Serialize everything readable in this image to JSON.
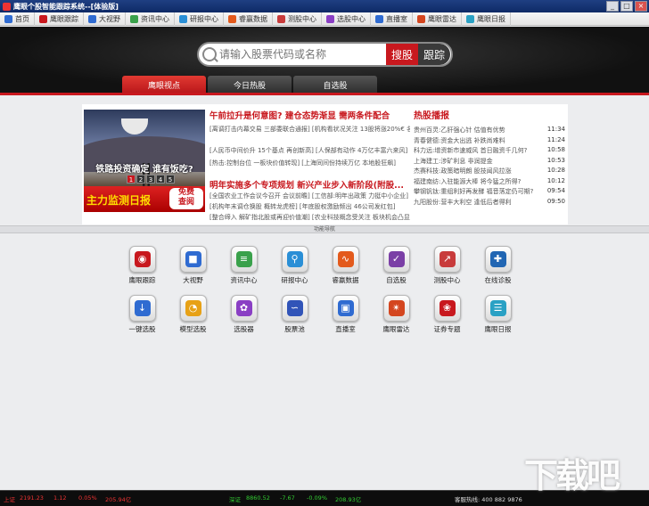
{
  "app": {
    "title": "鹰眼个股智能跟踪系统--[体验版]"
  },
  "window": {
    "minimize": "_",
    "maximize": "□",
    "close": "×"
  },
  "menu": [
    "首页",
    "鹰眼跟踪",
    "大视野",
    "资讯中心",
    "研报中心",
    "睿赢数据",
    "测股中心",
    "选股中心",
    "直播室",
    "鹰眼雷达",
    "鹰眼日报"
  ],
  "search": {
    "placeholder": "请输入股票代码或名称",
    "search_btn": "搜股",
    "follow_btn": "跟踪"
  },
  "tabs": [
    "鹰眼视点",
    "今日热股",
    "自选股"
  ],
  "banner": {
    "caption": "铁路投资确定 谁有饭吃?",
    "pages": [
      "1",
      "2",
      "3",
      "4",
      "5"
    ],
    "promo": "主力监测日报",
    "free_line1": "免费",
    "free_line2": "查阅"
  },
  "news": {
    "headline1": "午前拉升是何意图? 建仓态势渐显 需两条件配合",
    "items1": [
      "[离调打击内幕交易 三部委联合通报] [机构看状况关注 13股将涨20%€ 名单]",
      "[人民币中间价升 15个基点 再创新高] [人保部有动作 4万亿丰富六来风]",
      "[热击:控制台位 一板块价值转现] [上海同间份持续万亿 本地股狂飙]"
    ],
    "headline2": "明年实施多个专项规划 新兴产业步入新阶段(附股...",
    "items2": [
      "[全国农业工作会议今召开 会议前瞻] [工信部:明年出政策 力挺中小企业]",
      "[机构年末调仓换股 概转龙虎榜] [年底股权激励频出 46公司发红包]",
      "[整合缔入 解矿指北股或再迎价值潮] [农业科技概念受关注 板块机会凸显]"
    ]
  },
  "hot": {
    "title": "热股播报",
    "rows": [
      {
        "text": "贵州百灵:乙肝强心针 估值有优势",
        "time": "11:34"
      },
      {
        "text": "青春健德:资金大出逃 补跌尚难料",
        "time": "11:24"
      },
      {
        "text": "科力远:增资新市速威风 首日融资千几何?",
        "time": "10:58"
      },
      {
        "text": "上海建工:涉矿利息 非润提金",
        "time": "10:53"
      },
      {
        "text": "杰赛科技:政策暗明朗 股技闻风拉涨",
        "time": "10:28"
      },
      {
        "text": "福建南纺:入驻能源大棒 将今猛之所得?",
        "time": "10:12"
      },
      {
        "text": "攀钢钒钛:重组利好再发酵 福音落定仍可期?",
        "time": "09:54"
      },
      {
        "text": "九阳股份:营丰大利空 逢低后者得利",
        "time": "09:50"
      }
    ]
  },
  "section": {
    "title": "功能导航"
  },
  "functions": [
    {
      "label": "鹰眼跟踪",
      "icon": "eye-icon",
      "color": "#c8181e",
      "glyph": "◉"
    },
    {
      "label": "大视野",
      "icon": "camera-icon",
      "color": "#2f6bd1",
      "glyph": "■"
    },
    {
      "label": "资讯中心",
      "icon": "books-icon",
      "color": "#3aa14b",
      "glyph": "≡"
    },
    {
      "label": "研报中心",
      "icon": "magnifier-icon",
      "color": "#2a8fd6",
      "glyph": "⚲"
    },
    {
      "label": "睿赢数据",
      "icon": "wave-chart-icon",
      "color": "#e35a1c",
      "glyph": "∿"
    },
    {
      "label": "自选股",
      "icon": "checklist-icon",
      "color": "#7b3fa6",
      "glyph": "✓"
    },
    {
      "label": "测股中心",
      "icon": "line-chart-icon",
      "color": "#c83b3b",
      "glyph": "↗"
    },
    {
      "label": "在线诊股",
      "icon": "tools-icon",
      "color": "#2166b3",
      "glyph": "✚"
    },
    {
      "label": "一键选股",
      "icon": "download-arrow-icon",
      "color": "#2f6bd1",
      "glyph": "↓"
    },
    {
      "label": "模型选股",
      "icon": "pie-chart-icon",
      "color": "#e7a116",
      "glyph": "◔"
    },
    {
      "label": "选股器",
      "icon": "gear-icon",
      "color": "#8a3fc4",
      "glyph": "✿"
    },
    {
      "label": "股票池",
      "icon": "trend-icon",
      "color": "#3154b8",
      "glyph": "∽"
    },
    {
      "label": "直播室",
      "icon": "tv-icon",
      "color": "#2f6bd1",
      "glyph": "▣"
    },
    {
      "label": "鹰眼雷达",
      "icon": "radar-icon",
      "color": "#d4461f",
      "glyph": "✴"
    },
    {
      "label": "证券专题",
      "icon": "flower-icon",
      "color": "#c8181e",
      "glyph": "❀"
    },
    {
      "label": "鹰眼日报",
      "icon": "report-icon",
      "color": "#2aa1c4",
      "glyph": "☰"
    }
  ],
  "status": {
    "sh_label": "上证",
    "sh_value": "2191.23",
    "sh_change": "1.12",
    "sh_pct": "0.05%",
    "sh_amount": "205.94亿",
    "sz_label": "深证",
    "sz_value": "8860.52",
    "sz_change": "-7.67",
    "sz_pct": "-0.09%",
    "sz_amount": "208.93亿",
    "hotline": "客服热线: 400 882 9876"
  },
  "watermark": "下载吧"
}
